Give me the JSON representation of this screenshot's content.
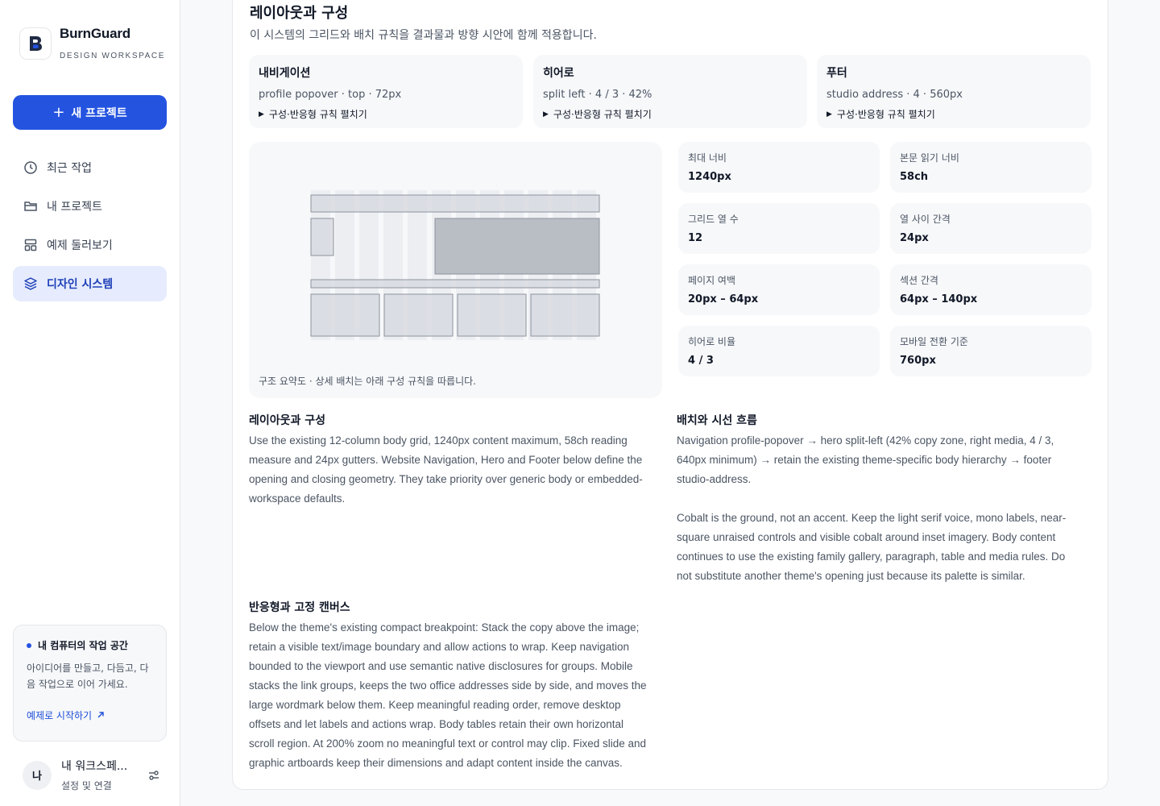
{
  "sidebar": {
    "brand": {
      "name": "BurnGuard",
      "subtitle": "DESIGN WORKSPACE",
      "logo_icon": "burnguard-logo-icon"
    },
    "new_project_label": "새 프로젝트",
    "nav": [
      {
        "label": "최근 작업",
        "icon": "clock-icon",
        "active": false
      },
      {
        "label": "내 프로젝트",
        "icon": "folder-icon",
        "active": false
      },
      {
        "label": "예제 둘러보기",
        "icon": "layout-icon",
        "active": false
      },
      {
        "label": "디자인 시스템",
        "icon": "layers-icon",
        "active": true
      }
    ],
    "workspace_card": {
      "title": "내 컴퓨터의 작업 공간",
      "description": "아이디어를 만들고, 다듬고, 다음 작업으로 이어 가세요.",
      "link": "예제로 시작하기"
    },
    "user": {
      "avatar": "나",
      "name": "내 워크스페...",
      "sub": "설정 및 연결"
    }
  },
  "main": {
    "title": "레이아웃과 구성",
    "subtitle": "이 시스템의 그리드와 배치 규칙을 결과물과 방향 시안에 함께 적용합니다.",
    "modules": [
      {
        "title": "내비게이션",
        "meta": "profile popover · top · 72px",
        "disclosure": "구성·반응형 규칙 펼치기"
      },
      {
        "title": "히어로",
        "meta": "split left · 4 / 3 · 42%",
        "disclosure": "구성·반응형 규칙 펼치기"
      },
      {
        "title": "푸터",
        "meta": "studio address · 4 · 560px",
        "disclosure": "구성·반응형 규칙 펼치기"
      }
    ],
    "diagram_caption": "구조 요약도 · 상세 배치는 아래 구성 규칙을 따릅니다.",
    "stats": [
      {
        "label": "최대 너비",
        "value": "1240px"
      },
      {
        "label": "본문 읽기 너비",
        "value": "58ch"
      },
      {
        "label": "그리드 열 수",
        "value": "12"
      },
      {
        "label": "열 사이 간격",
        "value": "24px"
      },
      {
        "label": "페이지 여백",
        "value": "20px – 64px"
      },
      {
        "label": "섹션 간격",
        "value": "64px – 140px"
      },
      {
        "label": "히어로 비율",
        "value": "4 / 3"
      },
      {
        "label": "모바일 전환 기준",
        "value": "760px"
      }
    ],
    "sections": {
      "layout": {
        "title": "레이아웃과 구성",
        "lines": [
          "Use the existing 12-column body grid, 1240px content maximum, 58ch reading",
          "measure and 24px gutters. Website Navigation, Hero and Footer below define the",
          "opening and closing geometry. They take priority over generic body or embedded-",
          "workspace defaults."
        ]
      },
      "flow": {
        "title": "배치와 시선 흐름",
        "lines": [
          "Navigation profile-popover → hero split-left (42% copy zone, right media, 4 / 3,",
          "640px minimum) → retain the existing theme-specific body hierarchy → footer",
          "studio-address.",
          "",
          "Cobalt is the ground, not an accent. Keep the light serif voice, mono labels, near-",
          "square unraised controls and visible cobalt around inset imagery. Body content",
          "continues to use the existing family gallery, paragraph, table and media rules. Do",
          "not substitute another theme's opening just because its palette is similar."
        ]
      },
      "responsive": {
        "title": "반응형과 고정 캔버스",
        "lines": [
          "Below the theme's existing compact breakpoint: Stack the copy above the image;",
          "retain a visible text/image boundary and allow actions to wrap. Keep navigation",
          "bounded to the viewport and use semantic native disclosures for groups. Mobile",
          "stacks the link groups, keeps the two office addresses side by side, and moves the",
          "large wordmark below them. Keep meaningful reading order, remove desktop",
          "offsets and let labels and actions wrap. Body tables retain their own horizontal",
          "scroll region. At 200% zoom no meaningful text or control may clip. Fixed slide and",
          "graphic artboards keep their dimensions and adapt content inside the canvas."
        ]
      }
    }
  },
  "colors": {
    "accent": "#2453e0",
    "active_bg": "#e6ecfd",
    "card_bg": "#f7f8fa"
  }
}
